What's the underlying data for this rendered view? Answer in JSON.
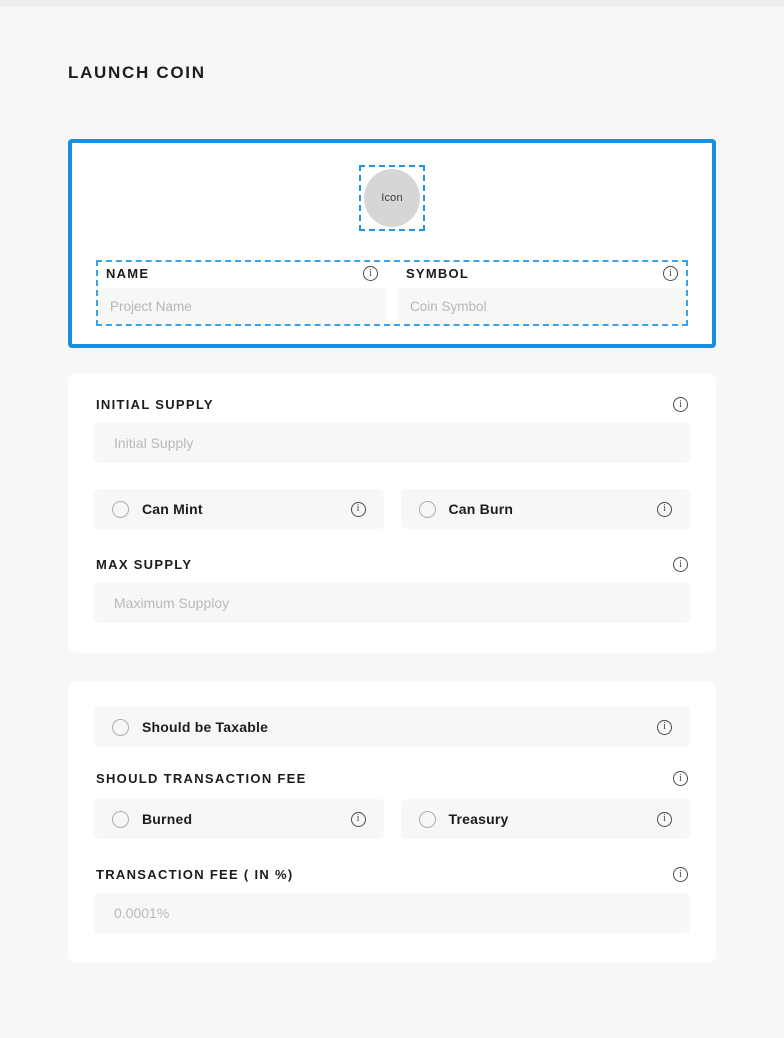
{
  "page": {
    "title": "LAUNCH COIN"
  },
  "identity_card": {
    "icon_uploader": {
      "label": "Icon"
    },
    "name_field": {
      "label": "NAME",
      "placeholder": "Project Name",
      "value": "",
      "info_icon": "info-icon"
    },
    "symbol_field": {
      "label": "SYMBOL",
      "placeholder": "Coin Symbol",
      "value": "",
      "info_icon": "info-icon"
    },
    "highlight_color": "#1a8fe0",
    "dashed_color": "#35a4e8"
  },
  "supply_card": {
    "initial_supply": {
      "label": "INITIAL SUPPLY",
      "placeholder": "Initial Supply",
      "value": ""
    },
    "options": [
      {
        "label": "Can Mint",
        "selected": false
      },
      {
        "label": "Can Burn",
        "selected": false
      }
    ],
    "max_supply": {
      "label": "MAX SUPPLY",
      "placeholder": "Maximum Supploy",
      "value": ""
    }
  },
  "tax_card": {
    "taxable_option": {
      "label": "Should be Taxable",
      "selected": false
    },
    "transaction_fee_section": {
      "label": "SHOULD TRANSACTION FEE",
      "options": [
        {
          "label": "Burned",
          "selected": false
        },
        {
          "label": "Treasury",
          "selected": false
        }
      ]
    },
    "fee_percent": {
      "label": "TRANSACTION FEE ( IN %)",
      "placeholder": "0.0001%",
      "value": ""
    }
  }
}
